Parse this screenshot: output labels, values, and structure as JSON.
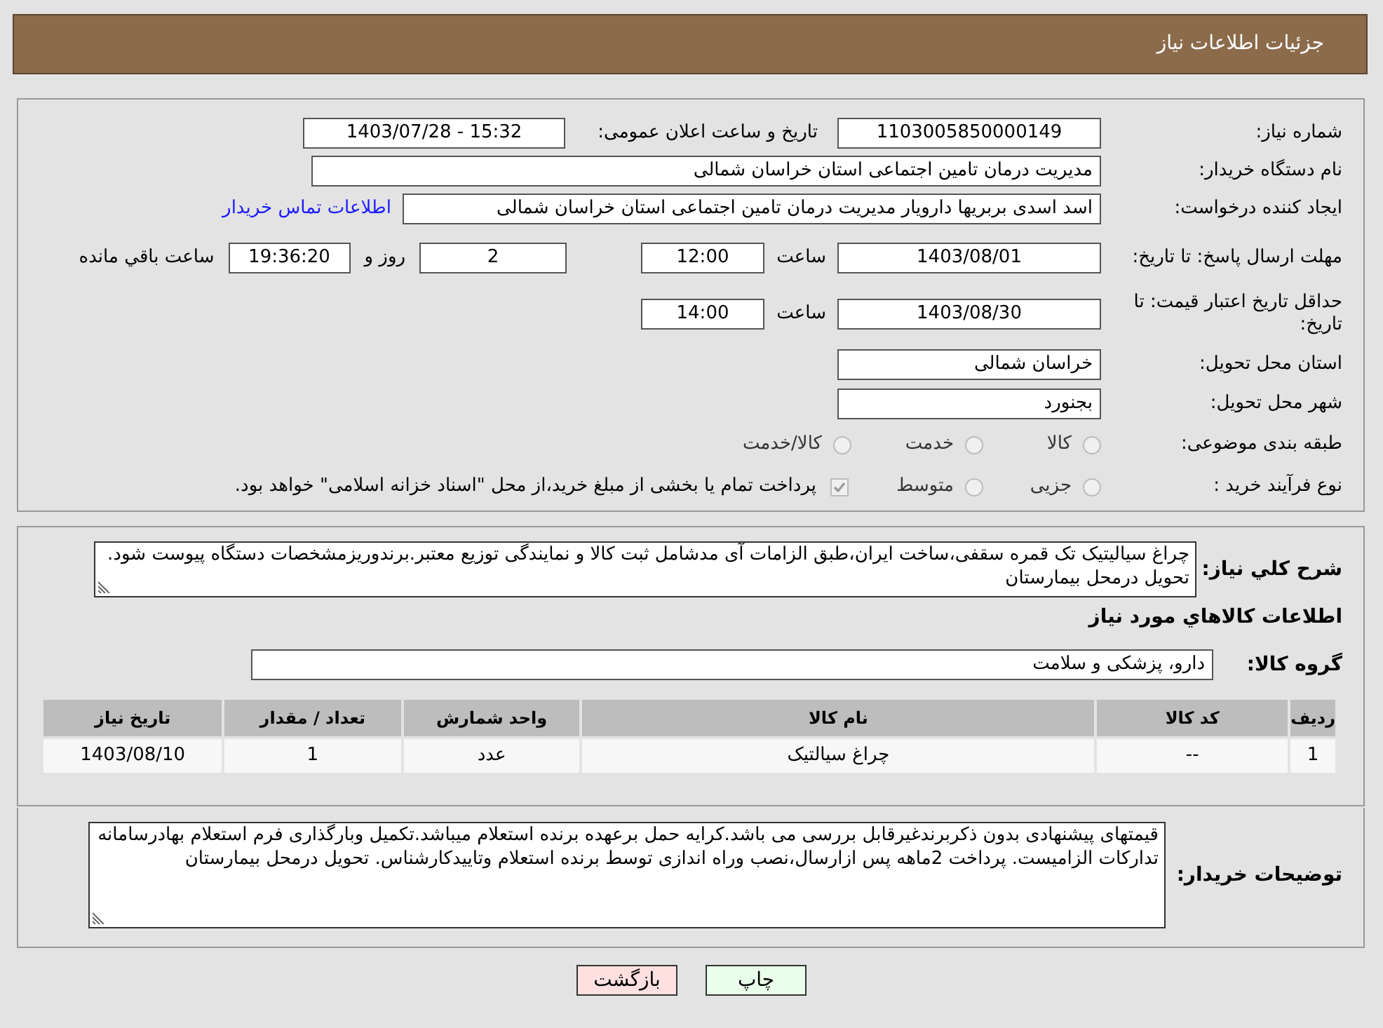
{
  "header": {
    "title": "جزئیات اطلاعات نیاز"
  },
  "need_number": {
    "label": "شماره نیاز:",
    "value": "1103005850000149"
  },
  "announce": {
    "label": "تاریخ و ساعت اعلان عمومی:",
    "value": "1403/07/28 - 15:32"
  },
  "buyer": {
    "label": "نام دستگاه خریدار:",
    "value": "مدیریت درمان تامین اجتماعی استان خراسان شمالی"
  },
  "requester": {
    "label": "ایجاد کننده درخواست:",
    "value": "اسد اسدی بربریها دارویار مدیریت درمان تامین اجتماعی استان خراسان شمالی",
    "link": "اطلاعات تماس خریدار"
  },
  "response_deadline": {
    "label": "مهلت ارسال پاسخ: تا تاریخ:",
    "date": "1403/08/01",
    "time_label": "ساعت",
    "time": "12:00",
    "days": "2",
    "days_label": "روز و",
    "remaining": "19:36:20",
    "remaining_label": "ساعت باقي مانده"
  },
  "price_validity": {
    "label": "حداقل تاریخ اعتبار قیمت: تا تاریخ:",
    "date": "1403/08/30",
    "time_label": "ساعت",
    "time": "14:00"
  },
  "delivery_province": {
    "label": "استان محل تحویل:",
    "value": "خراسان شمالی"
  },
  "delivery_city": {
    "label": "شهر محل تحویل:",
    "value": "بجنورد"
  },
  "category": {
    "label": "طبقه بندی موضوعی:",
    "options": [
      {
        "label": "کالا",
        "selected": false
      },
      {
        "label": "خدمت",
        "selected": false
      },
      {
        "label": "کالا/خدمت",
        "selected": false
      }
    ]
  },
  "purchase_type": {
    "label": "نوع فرآیند خرید :",
    "options": [
      {
        "label": "جزیی",
        "selected": false
      },
      {
        "label": "متوسط",
        "selected": false
      }
    ],
    "payment_note": {
      "checked": true,
      "text": "پرداخت تمام یا بخشی از مبلغ خرید،از محل \"اسناد خزانه اسلامی\" خواهد بود."
    }
  },
  "description": {
    "label": "شرح کلي نياز:",
    "value": "چراغ سیالیتیک تک قمره سقفی،ساخت ایران،طبق الزامات آی مدشامل ثبت کالا و نمایندگی توزیع معتبر.برندوریزمشخصات دستگاه پیوست شود. تحویل درمحل بیمارستان"
  },
  "items_heading": "اطلاعات کالاهاي مورد نياز",
  "goods_group": {
    "label": "گروه کالا:",
    "value": "دارو، پزشکی و سلامت"
  },
  "table": {
    "columns": [
      "رديف",
      "کد کالا",
      "نام کالا",
      "واحد شمارش",
      "تعداد / مقدار",
      "تاریخ نیاز"
    ],
    "rows": [
      [
        "1",
        "--",
        "چراغ سیالتیک",
        "عدد",
        "1",
        "1403/08/10"
      ]
    ]
  },
  "buyer_notes": {
    "label": "توضیحات خریدار:",
    "value": "قیمتهای پیشنهادی بدون ذکربرندغیرقابل بررسی می باشد.کرایه حمل برعهده برنده استعلام میباشد.تکمیل وبارگذاری فرم استعلام بهادرسامانه تدارکات الزامیست. پرداخت 2ماهه پس ازارسال،نصب وراه اندازی توسط برنده استعلام وتاییدکارشناس. تحویل درمحل بیمارستان"
  },
  "buttons": [
    {
      "label": "چاپ",
      "kind": "print"
    },
    {
      "label": "بازگشت",
      "kind": "back"
    }
  ]
}
